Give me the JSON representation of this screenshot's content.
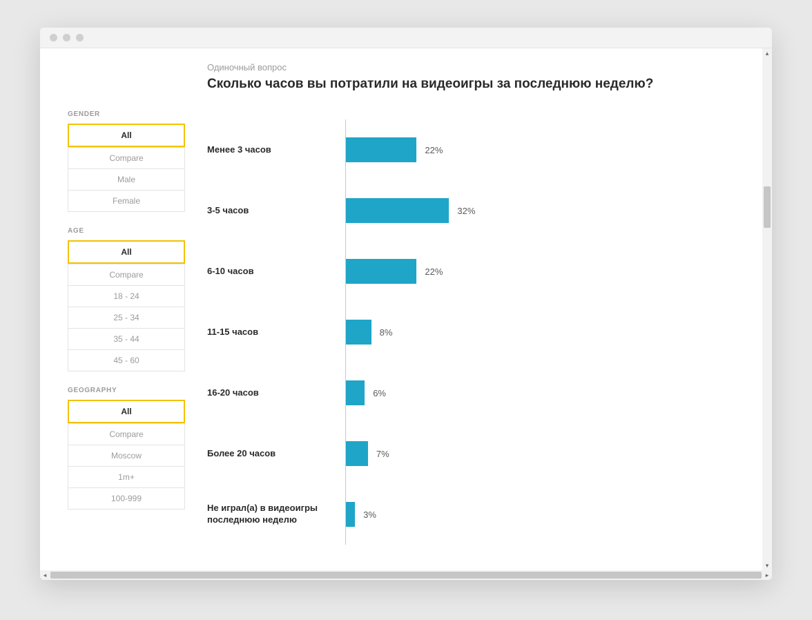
{
  "header": {
    "eyebrow": "Одиночный вопрос",
    "title": "Сколько часов вы потратили на видеоигры за последнюю неделю?"
  },
  "sidebar": {
    "groups": [
      {
        "name": "GENDER",
        "items": [
          {
            "label": "All",
            "active": true
          },
          {
            "label": "Compare",
            "active": false
          },
          {
            "label": "Male",
            "active": false
          },
          {
            "label": "Female",
            "active": false
          }
        ]
      },
      {
        "name": "AGE",
        "items": [
          {
            "label": "All",
            "active": true
          },
          {
            "label": "Compare",
            "active": false
          },
          {
            "label": "18 - 24",
            "active": false
          },
          {
            "label": "25 - 34",
            "active": false
          },
          {
            "label": "35 - 44",
            "active": false
          },
          {
            "label": "45 - 60",
            "active": false
          }
        ]
      },
      {
        "name": "GEOGRAPHY",
        "items": [
          {
            "label": "All",
            "active": true
          },
          {
            "label": "Compare",
            "active": false
          },
          {
            "label": "Moscow",
            "active": false
          },
          {
            "label": "1m+",
            "active": false
          },
          {
            "label": "100-999",
            "active": false
          }
        ]
      }
    ]
  },
  "chart_data": {
    "type": "bar",
    "title": "Сколько часов вы потратили на видеоигры за последнюю неделю?",
    "xlabel": "",
    "ylabel": "",
    "categories": [
      "Менее 3 часов",
      "3-5 часов",
      "6-10 часов",
      "11-15 часов",
      "16-20 часов",
      "Более 20 часов",
      "Не играл(а) в видеоигры последнюю неделю"
    ],
    "values": [
      22,
      32,
      22,
      8,
      6,
      7,
      3
    ],
    "value_suffix": "%",
    "bar_color": "#1fa5c8",
    "xlim": [
      0,
      100
    ]
  }
}
